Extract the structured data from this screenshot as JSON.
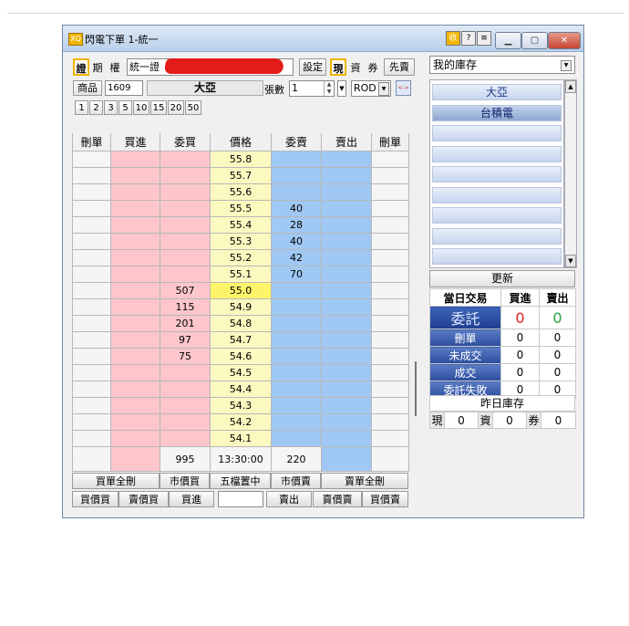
{
  "window": {
    "title": "閃電下單 1-統一",
    "icon_text": "XQ"
  },
  "titlebar_tools": [
    "收",
    "?",
    "≡"
  ],
  "toolbar": {
    "cert_label": "證",
    "period_label": "期",
    "right_label": "權",
    "account_prefix": "統一證",
    "settings_label": "設定",
    "cash_label": "現",
    "margin_label": "資",
    "short_label": "券",
    "sell_first_label": "先賣"
  },
  "product": {
    "label": "商品",
    "code": "1609",
    "name": "大亞",
    "qty_label": "張數",
    "qty_value": "1",
    "order_type": "ROD",
    "link_icon": "<->"
  },
  "qty_presets": [
    "1",
    "2",
    "3",
    "5",
    "10",
    "15",
    "20",
    "50"
  ],
  "orderbook": {
    "headers": [
      "刪單",
      "買進",
      "委買",
      "價格",
      "委賣",
      "賣出",
      "刪單"
    ],
    "rows": [
      {
        "bid_qty": "",
        "price": "55.8",
        "ask_qty": ""
      },
      {
        "bid_qty": "",
        "price": "55.7",
        "ask_qty": ""
      },
      {
        "bid_qty": "",
        "price": "55.6",
        "ask_qty": ""
      },
      {
        "bid_qty": "",
        "price": "55.5",
        "ask_qty": "40"
      },
      {
        "bid_qty": "",
        "price": "55.4",
        "ask_qty": "28"
      },
      {
        "bid_qty": "",
        "price": "55.3",
        "ask_qty": "40"
      },
      {
        "bid_qty": "",
        "price": "55.2",
        "ask_qty": "42"
      },
      {
        "bid_qty": "",
        "price": "55.1",
        "ask_qty": "70"
      },
      {
        "bid_qty": "507",
        "price": "55.0",
        "ask_qty": ""
      },
      {
        "bid_qty": "115",
        "price": "54.9",
        "ask_qty": ""
      },
      {
        "bid_qty": "201",
        "price": "54.8",
        "ask_qty": ""
      },
      {
        "bid_qty": "97",
        "price": "54.7",
        "ask_qty": ""
      },
      {
        "bid_qty": "75",
        "price": "54.6",
        "ask_qty": ""
      },
      {
        "bid_qty": "",
        "price": "54.5",
        "ask_qty": ""
      },
      {
        "bid_qty": "",
        "price": "54.4",
        "ask_qty": ""
      },
      {
        "bid_qty": "",
        "price": "54.3",
        "ask_qty": ""
      },
      {
        "bid_qty": "",
        "price": "54.2",
        "ask_qty": ""
      },
      {
        "bid_qty": "",
        "price": "54.1",
        "ask_qty": ""
      }
    ],
    "current_price": "55.0",
    "total_bid": "995",
    "time": "13:30:00",
    "total_ask": "220"
  },
  "actions": {
    "row1": [
      "買單全刪",
      "市價買",
      "五檔置中",
      "市價賣",
      "賣單全刪"
    ],
    "row2": [
      "買價買",
      "賣價買",
      "買進",
      "",
      "賣出",
      "賣價賣",
      "買價賣"
    ]
  },
  "right_panel": {
    "dropdown": "我的庫存",
    "stocks": [
      "大亞",
      "台積電",
      "",
      "",
      "",
      "",
      "",
      "",
      ""
    ],
    "refresh_label": "更新",
    "today_headers": [
      "當日交易",
      "買進",
      "賣出"
    ],
    "today_rows": [
      {
        "label": "委託",
        "buy": "0",
        "sell": "0"
      },
      {
        "label": "刪單",
        "buy": "0",
        "sell": "0"
      },
      {
        "label": "未成交",
        "buy": "0",
        "sell": "0"
      },
      {
        "label": "成交",
        "buy": "0",
        "sell": "0"
      },
      {
        "label": "委託失敗",
        "buy": "0",
        "sell": "0"
      }
    ],
    "yesterday_label": "昨日庫存",
    "inventory": [
      {
        "k": "現",
        "v": "0"
      },
      {
        "k": "資",
        "v": "0"
      },
      {
        "k": "券",
        "v": "0"
      }
    ]
  },
  "colors": {
    "buy": "#fcc6cb",
    "sell": "#a0c8f4",
    "price": "#fcf9c0",
    "current": "#fdf46a",
    "buy_zero": "#e02020",
    "sell_zero": "#20a040"
  }
}
